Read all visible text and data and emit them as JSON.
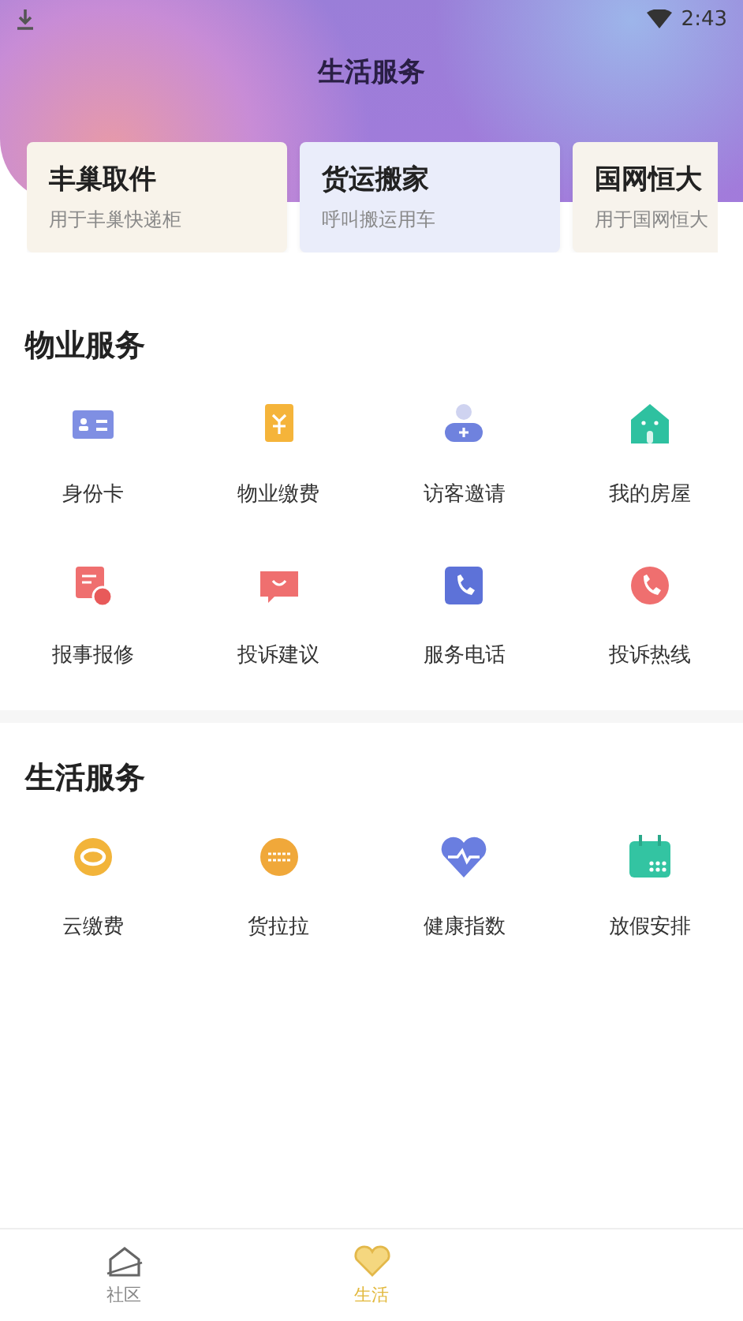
{
  "status_bar": {
    "time": "2:43"
  },
  "header": {
    "title": "生活服务"
  },
  "cards": [
    {
      "title": "丰巢取件",
      "subtitle": "用于丰巢快递柜",
      "color": "#f8f3ea"
    },
    {
      "title": "货运搬家",
      "subtitle": "呼叫搬运用车",
      "color": "#eaedfa"
    },
    {
      "title": "国网恒大",
      "subtitle": "用于国网恒大",
      "color": "#f7f3ec"
    }
  ],
  "sections": [
    {
      "title": "物业服务",
      "items": [
        {
          "label": "身份卡"
        },
        {
          "label": "物业缴费"
        },
        {
          "label": "访客邀请"
        },
        {
          "label": "我的房屋"
        },
        {
          "label": "报事报修"
        },
        {
          "label": "投诉建议"
        },
        {
          "label": "服务电话"
        },
        {
          "label": "投诉热线"
        }
      ]
    },
    {
      "title": "生活服务",
      "items": [
        {
          "label": "云缴费"
        },
        {
          "label": "货拉拉"
        },
        {
          "label": "健康指数"
        },
        {
          "label": "放假安排"
        }
      ]
    }
  ],
  "tabs": [
    {
      "label": "社区",
      "selected": false
    },
    {
      "label": "生活",
      "selected": true
    }
  ]
}
